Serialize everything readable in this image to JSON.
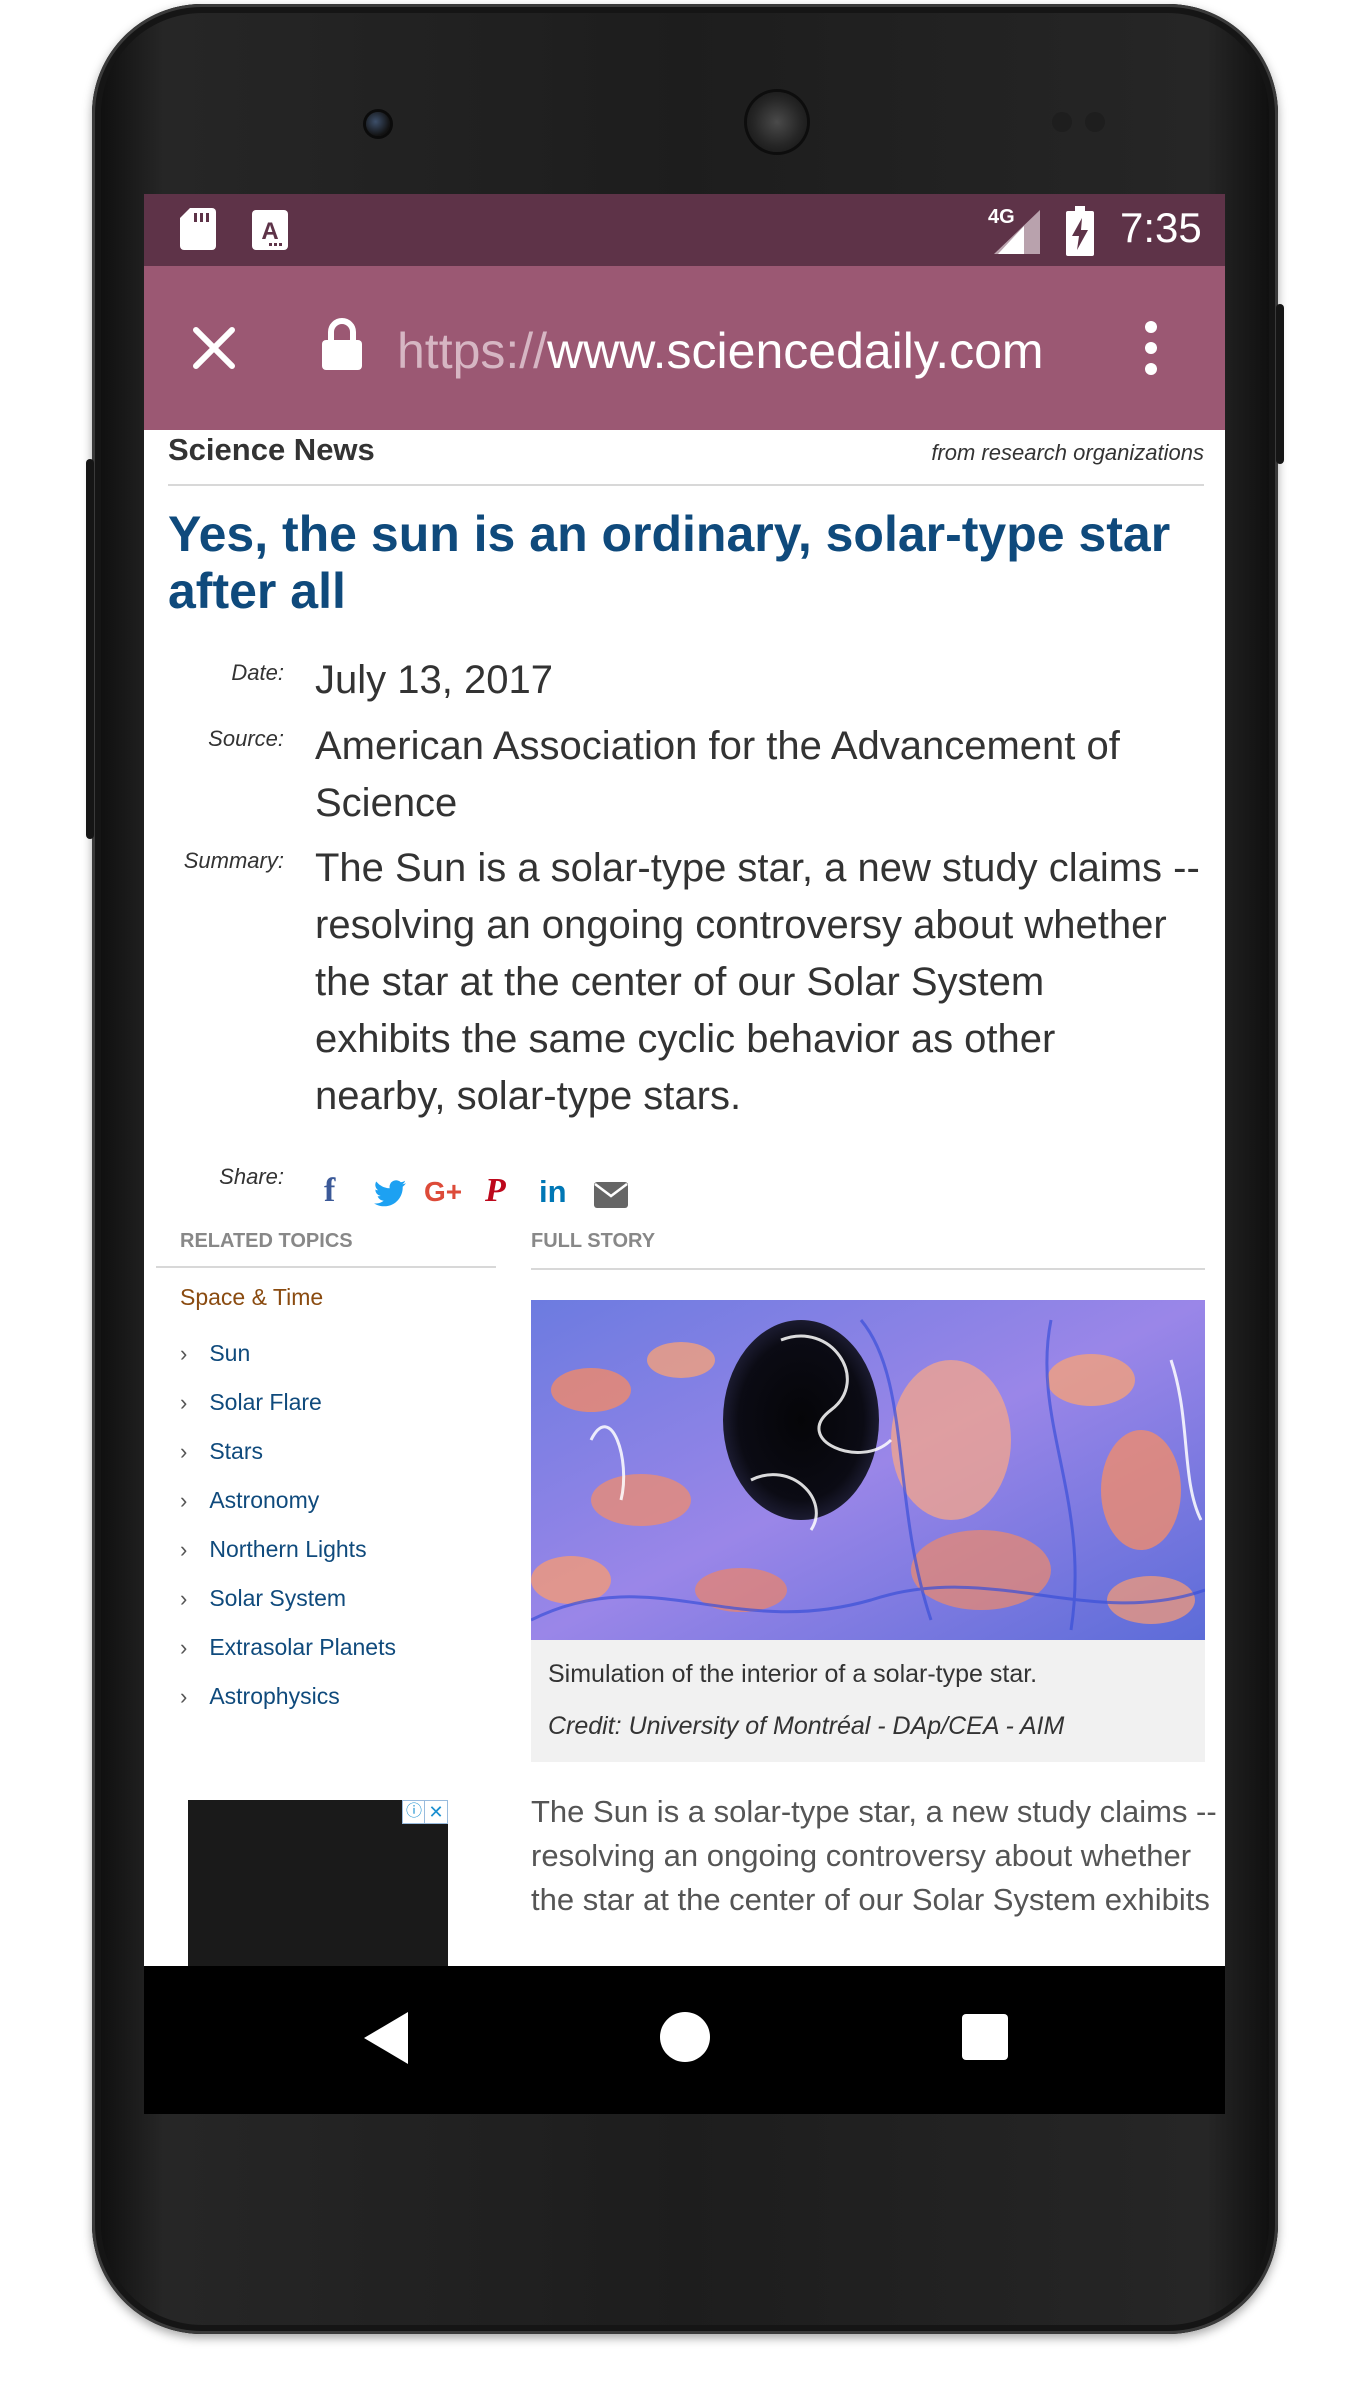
{
  "status_bar": {
    "time": "7:35",
    "network": "4G",
    "icons": [
      "sd-card-icon",
      "font-app-icon",
      "signal-icon",
      "battery-charging-icon"
    ]
  },
  "browser": {
    "url_scheme": "https://",
    "url_host": "www.sciencedaily.com",
    "icons": [
      "close-icon",
      "lock-icon",
      "more-vert-icon"
    ]
  },
  "header": {
    "brand": "Science News",
    "tagline": "from research organizations"
  },
  "article": {
    "title": "Yes, the sun is an ordinary, solar-type star after all",
    "date_label": "Date:",
    "date": "July 13, 2017",
    "source_label": "Source:",
    "source_line1": "American Association for the Advancement of",
    "source_line2": "Science",
    "summary_label": "Summary:",
    "summary_lines": [
      "The Sun is a solar-type star, a new study claims --",
      "resolving an ongoing controversy about whether",
      "the star at the center of our Solar System",
      "exhibits the same cyclic behavior as other",
      "nearby, solar-type stars."
    ],
    "share_label": "Share:",
    "share_icons": [
      {
        "name": "facebook-icon",
        "glyph": "f",
        "color": "#3b5998"
      },
      {
        "name": "twitter-icon",
        "glyph": "🐦",
        "color": "#1da1f2"
      },
      {
        "name": "google-plus-icon",
        "glyph": "G+",
        "color": "#dd4b39"
      },
      {
        "name": "pinterest-icon",
        "glyph": "P",
        "color": "#bd081c"
      },
      {
        "name": "linkedin-icon",
        "glyph": "in",
        "color": "#0077b5"
      },
      {
        "name": "email-icon",
        "glyph": "✉",
        "color": "#666666"
      }
    ]
  },
  "related": {
    "heading": "RELATED TOPICS",
    "category": "Space & Time",
    "topics": [
      "Sun",
      "Solar Flare",
      "Stars",
      "Astronomy",
      "Northern Lights",
      "Solar System",
      "Extrasolar Planets",
      "Astrophysics"
    ]
  },
  "full_story": {
    "heading": "FULL STORY",
    "image_caption": "Simulation of the interior of a solar-type star.",
    "image_credit": "Credit: University of Montréal - DAp/CEA - AIM",
    "body_lines": [
      "The Sun is a solar-type star, a new study claims --",
      "resolving an ongoing controversy about whether",
      "the star at the center of our Solar System exhibits"
    ]
  },
  "ad": {
    "icons": [
      "adchoices-icon",
      "ad-close-icon"
    ]
  },
  "nav_bar": {
    "icons": [
      "back-icon",
      "home-icon",
      "recents-icon"
    ]
  },
  "colors": {
    "status_bar": "#5e3348",
    "toolbar": "#9b5873",
    "title_blue": "#0f4a7c",
    "category_brown": "#8a4b10"
  }
}
